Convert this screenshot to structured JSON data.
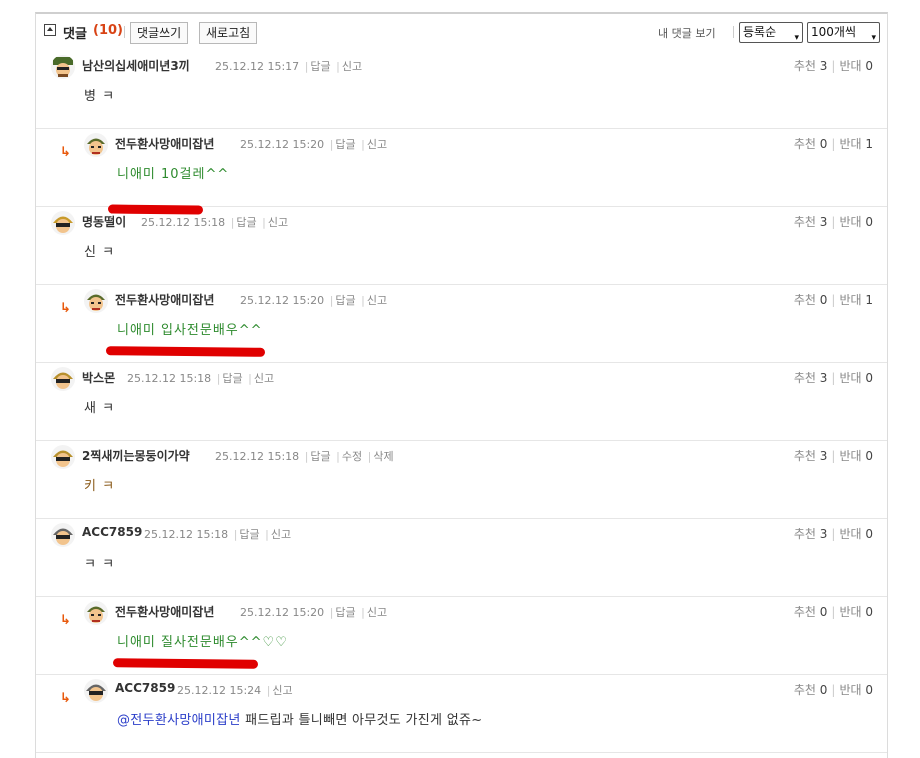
{
  "header": {
    "title": "댓글",
    "count": "(10)",
    "write_label": "댓글쓰기",
    "refresh_label": "새로고침",
    "my_comments_label": "내 댓글 보기",
    "sort_value": "등록순",
    "page_size_value": "100개씩",
    "dropdown_arrow": "▾"
  },
  "labels": {
    "reply": "답글",
    "report": "신고",
    "edit": "수정",
    "delete": "삭제",
    "up": "추천",
    "down": "반대",
    "reply_arrow": "↳"
  },
  "comments": [
    {
      "nick": "남산의십세애미년3끼",
      "time": "25.12.12 15:17",
      "text": "병 ㅋ",
      "up": "3",
      "down": "0",
      "reply": false
    },
    {
      "nick": "전두환사망애미잡년",
      "time": "25.12.12 15:20",
      "text": "니애미 10걸레^^",
      "up": "0",
      "down": "1",
      "reply": true
    },
    {
      "nick": "명동떨이",
      "time": "25.12.12 15:18",
      "text": "신 ㅋ",
      "up": "3",
      "down": "0",
      "reply": false
    },
    {
      "nick": "전두환사망애미잡년",
      "time": "25.12.12 15:20",
      "text": "니애미 입사전문배우^^",
      "up": "0",
      "down": "1",
      "reply": true
    },
    {
      "nick": "박스몬",
      "time": "25.12.12 15:18",
      "text": "새 ㅋ",
      "up": "3",
      "down": "0",
      "reply": false
    },
    {
      "nick": "2찍새끼는몽둥이가약",
      "time": "25.12.12 15:18",
      "text": "키 ㅋ",
      "up": "3",
      "down": "0",
      "reply": false
    },
    {
      "nick": "ACC7859",
      "time": "25.12.12 15:18",
      "text": "ㅋ ㅋ",
      "up": "3",
      "down": "0",
      "reply": false
    },
    {
      "nick": "전두환사망애미잡년",
      "time": "25.12.12 15:20",
      "text": "니애미 질사전문배우^^♡♡",
      "up": "0",
      "down": "0",
      "reply": true
    },
    {
      "nick": "ACC7859",
      "time": "25.12.12 15:24",
      "mention": "@전두환사망애미잡년",
      "text": " 패드립과 틀니빼면 아무것도 가진게 없쥬~",
      "up": "0",
      "down": "0",
      "reply": true
    }
  ]
}
